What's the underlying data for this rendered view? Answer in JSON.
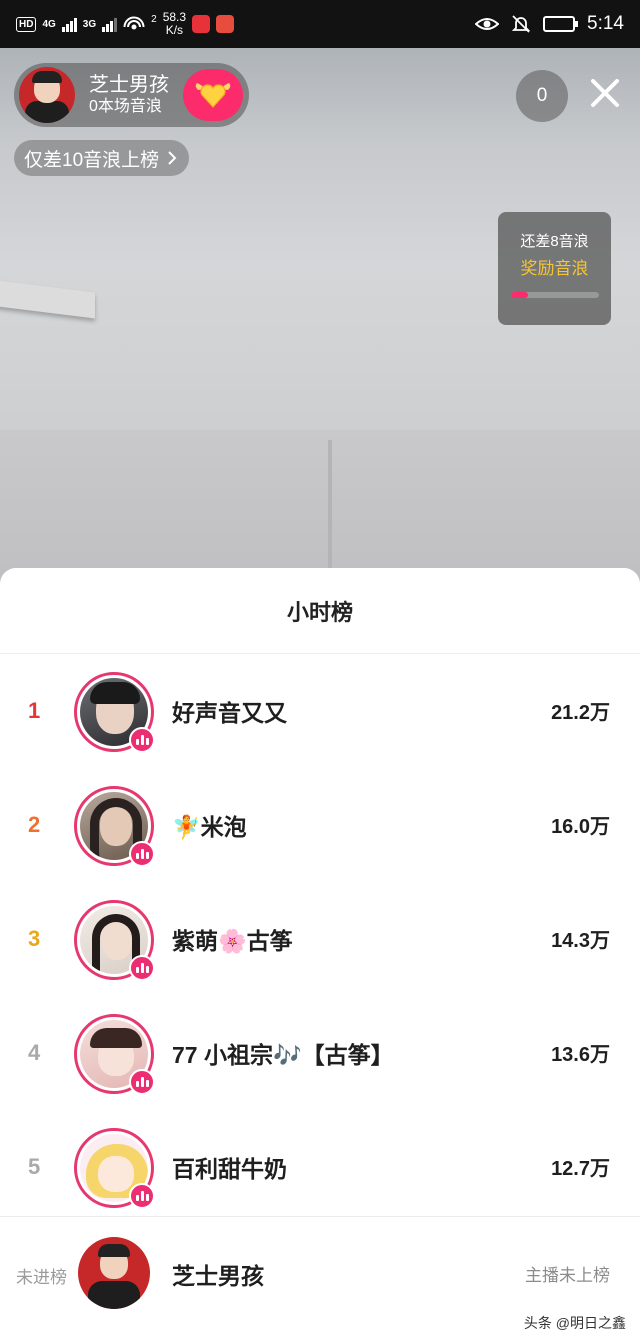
{
  "status_bar": {
    "hd_chip": "HD",
    "net1": "4G",
    "net2": "3G",
    "wifi_num": "2",
    "speed_value": "58.3",
    "speed_unit": "K/s",
    "time": "5:14"
  },
  "live": {
    "anchor_name": "芝士男孩",
    "anchor_sub": "0本场音浪",
    "rank_hint": "仅差10音浪上榜",
    "viewer_count": "0",
    "reward_line1": "还差8音浪",
    "reward_line2": "奖励音浪",
    "reward_progress": 0.2
  },
  "sheet": {
    "title": "小时榜",
    "rows": [
      {
        "rank": "1",
        "name": "好声音又又",
        "score": "21.2万",
        "rank_color": "#e4373b"
      },
      {
        "rank": "2",
        "name": "🧚米泡",
        "score": "16.0万",
        "rank_color": "#ef7132"
      },
      {
        "rank": "3",
        "name": "紫萌🌸古筝",
        "score": "14.3万",
        "rank_color": "#e9a81c"
      },
      {
        "rank": "4",
        "name": "77 小祖宗🎶【古筝】",
        "score": "13.6万",
        "rank_color": "#a9a9a9"
      },
      {
        "rank": "5",
        "name": "百利甜牛奶",
        "score": "12.7万",
        "rank_color": "#a9a9a9"
      }
    ],
    "me": {
      "label": "未进榜",
      "name": "芝士男孩",
      "status": "主播未上榜"
    }
  },
  "watermark": "头条 @明日之鑫",
  "colors": {
    "accent_pink": "#fc2b6b",
    "gold": "#f7c531"
  }
}
